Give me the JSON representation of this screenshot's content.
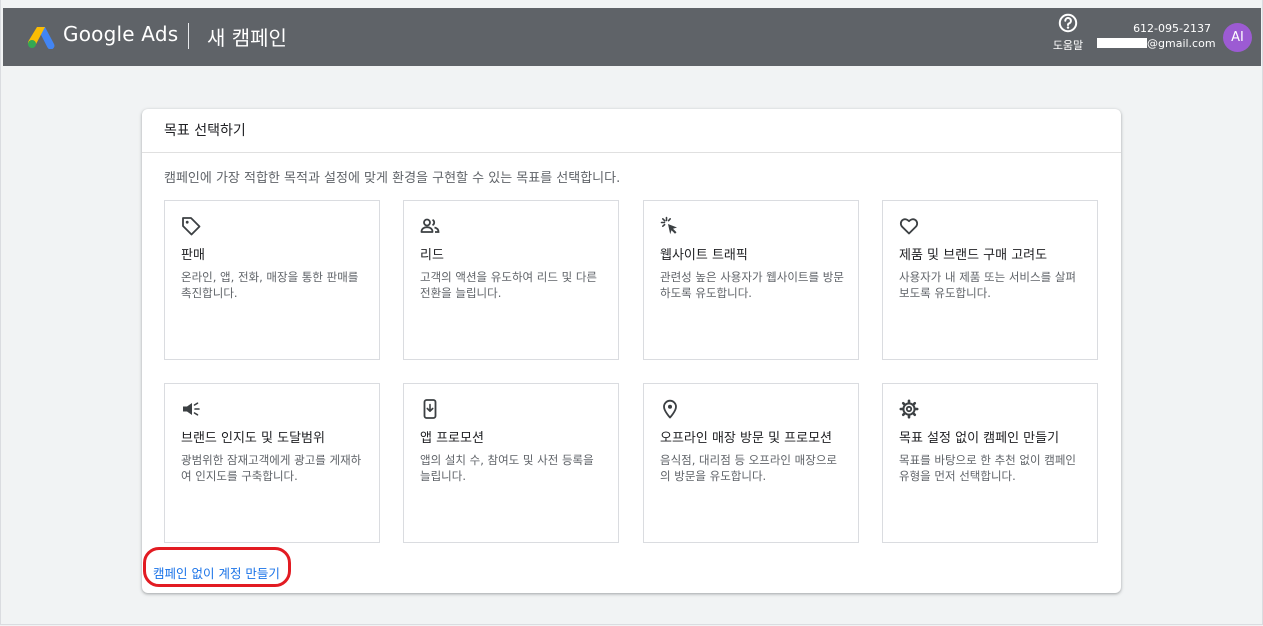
{
  "header": {
    "brand": "Google Ads",
    "page_title": "새 캠페인",
    "help_label": "도움말",
    "account_id": "612-095-2137",
    "email_suffix": "@gmail.com",
    "avatar_initials": "AI",
    "logo_colors": [
      "#fbbc04",
      "#4285f4",
      "#34a853"
    ],
    "avatar_color": "#9c5bd3"
  },
  "card": {
    "title": "목표 선택하기",
    "description": "캠페인에 가장 적합한 목적과 설정에 맞게 환경을 구현할 수 있는 목표를 선택합니다.",
    "goals": [
      {
        "icon": "tag-icon",
        "title": "판매",
        "description": "온라인, 앱, 전화, 매장을 통한 판매를 촉진합니다."
      },
      {
        "icon": "people-icon",
        "title": "리드",
        "description": "고객의 액션을 유도하여 리드 및 다른 전환을 늘립니다."
      },
      {
        "icon": "click-icon",
        "title": "웹사이트 트래픽",
        "description": "관련성 높은 사용자가 웹사이트를 방문하도록 유도합니다."
      },
      {
        "icon": "heart-icon",
        "title": "제품 및 브랜드 구매 고려도",
        "description": "사용자가 내 제품 또는 서비스를 살펴보도록 유도합니다."
      },
      {
        "icon": "megaphone-icon",
        "title": "브랜드 인지도 및 도달범위",
        "description": "광범위한 잠재고객에게 광고를 게재하여 인지도를 구축합니다."
      },
      {
        "icon": "phone-download-icon",
        "title": "앱 프로모션",
        "description": "앱의 설치 수, 참여도 및 사전 등록을 늘립니다."
      },
      {
        "icon": "location-pin-icon",
        "title": "오프라인 매장 방문 및 프로모션",
        "description": "음식점, 대리점 등 오프라인 매장으로의 방문을 유도합니다."
      },
      {
        "icon": "gear-icon",
        "title": "목표 설정 없이 캠페인 만들기",
        "description": "목표를 바탕으로 한 추천 없이 캠페인 유형을 먼저 선택합니다."
      }
    ],
    "no_campaign_link": "캠페인 없이 계정 만들기",
    "link_color": "#1a73e8",
    "highlight_color": "#e21b22"
  }
}
